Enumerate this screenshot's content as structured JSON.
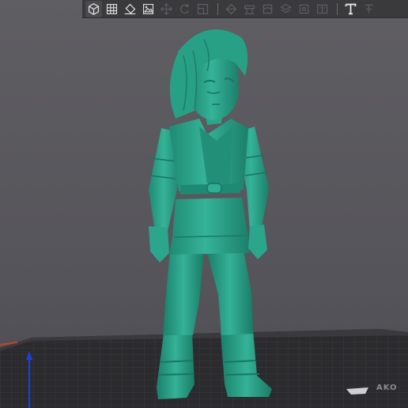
{
  "toolbar": {
    "buttons": [
      {
        "name": "perspective-cube-icon",
        "state": "enabled"
      },
      {
        "name": "grid-icon",
        "state": "enabled"
      },
      {
        "name": "paint-brush-icon",
        "state": "enabled"
      },
      {
        "name": "image-export-icon",
        "state": "enabled"
      },
      {
        "name": "move-arrows-icon",
        "state": "disabled"
      },
      {
        "name": "rotate-icon",
        "state": "disabled"
      },
      {
        "name": "scale-icon",
        "state": "disabled"
      },
      {
        "name": "cut-icon",
        "state": "disabled"
      },
      {
        "name": "support-icon",
        "state": "disabled"
      },
      {
        "name": "seam-icon",
        "state": "disabled"
      },
      {
        "name": "layer-icon",
        "state": "disabled"
      },
      {
        "name": "hollow-icon",
        "state": "disabled"
      },
      {
        "name": "split-icon",
        "state": "disabled"
      },
      {
        "name": "text-tool-icon",
        "state": "enabled"
      },
      {
        "name": "measure-icon",
        "state": "disabled"
      }
    ]
  },
  "scene": {
    "model_color": "#2aa088",
    "bed_label": "AKO"
  },
  "colors": {
    "background": "#5a595e",
    "bed": "#2e2e31",
    "axis_z": "#1f3fd6",
    "axis_x": "#c2442e"
  }
}
